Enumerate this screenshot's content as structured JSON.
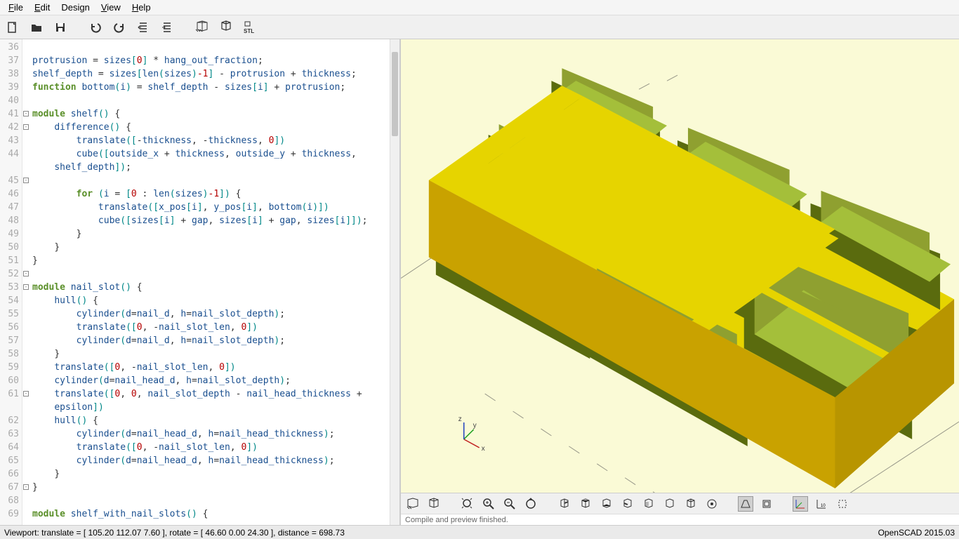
{
  "menu": {
    "file": "File",
    "edit": "Edit",
    "design": "Design",
    "view": "View",
    "help": "Help"
  },
  "code": {
    "lines": [
      {
        "n": 36,
        "t": ""
      },
      {
        "n": 37,
        "t": "protrusion = sizes[0] * hang_out_fraction;"
      },
      {
        "n": 38,
        "t": "shelf_depth = sizes[len(sizes)-1] - protrusion + thickness;"
      },
      {
        "n": 39,
        "t": "function bottom(i) = shelf_depth - sizes[i] + protrusion;"
      },
      {
        "n": 40,
        "t": ""
      },
      {
        "n": 41,
        "t": "module shelf() {",
        "fold": true
      },
      {
        "n": 42,
        "t": "    difference() {",
        "fold": true
      },
      {
        "n": 43,
        "t": "        translate([-thickness, -thickness, 0])"
      },
      {
        "n": 44,
        "t": "        cube([outside_x + thickness, outside_y + thickness, shelf_depth]);"
      },
      {
        "n": 45,
        "t": ""
      },
      {
        "n": 46,
        "t": "        for (i = [0 : len(sizes)-1]) {",
        "fold": true
      },
      {
        "n": 47,
        "t": "            translate([x_pos[i], y_pos[i], bottom(i)])"
      },
      {
        "n": 48,
        "t": "            cube([sizes[i] + gap, sizes[i] + gap, sizes[i]]);"
      },
      {
        "n": 49,
        "t": "        }"
      },
      {
        "n": 50,
        "t": "    }"
      },
      {
        "n": 51,
        "t": "}"
      },
      {
        "n": 52,
        "t": ""
      },
      {
        "n": 53,
        "t": "module nail_slot() {",
        "fold": true
      },
      {
        "n": 54,
        "t": "    hull() {",
        "fold": true
      },
      {
        "n": 55,
        "t": "        cylinder(d=nail_d, h=nail_slot_depth);"
      },
      {
        "n": 56,
        "t": "        translate([0, -nail_slot_len, 0])"
      },
      {
        "n": 57,
        "t": "        cylinder(d=nail_d, h=nail_slot_depth);"
      },
      {
        "n": 58,
        "t": "    }"
      },
      {
        "n": 59,
        "t": "    translate([0, -nail_slot_len, 0])"
      },
      {
        "n": 60,
        "t": "    cylinder(d=nail_head_d, h=nail_slot_depth);"
      },
      {
        "n": 61,
        "t": "    translate([0, 0, nail_slot_depth - nail_head_thickness + epsilon])"
      },
      {
        "n": 62,
        "t": "    hull() {",
        "fold": true
      },
      {
        "n": 63,
        "t": "        cylinder(d=nail_head_d, h=nail_head_thickness);"
      },
      {
        "n": 64,
        "t": "        translate([0, -nail_slot_len, 0])"
      },
      {
        "n": 65,
        "t": "        cylinder(d=nail_head_d, h=nail_head_thickness);"
      },
      {
        "n": 66,
        "t": "    }"
      },
      {
        "n": 67,
        "t": "}"
      },
      {
        "n": 68,
        "t": ""
      },
      {
        "n": 69,
        "t": "module shelf_with_nail_slots() {",
        "fold": true
      }
    ]
  },
  "console": "Compile and preview finished.",
  "status": {
    "left": "Viewport: translate = [ 105.20 112.07 7.60 ], rotate = [ 46.60 0.00 24.30 ], distance = 698.73",
    "right": "OpenSCAD 2015.03"
  },
  "axes": {
    "x": "x",
    "y": "y",
    "z": "z"
  }
}
